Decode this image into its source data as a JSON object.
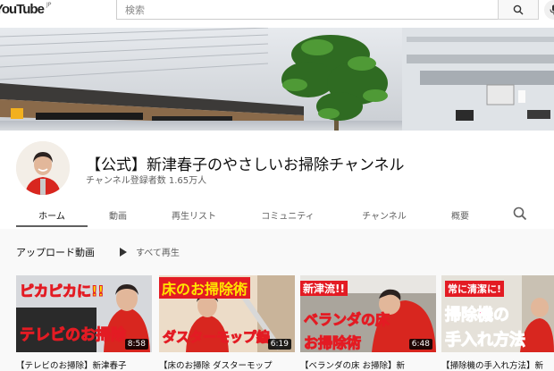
{
  "masthead": {
    "logo_text": "YouTube",
    "logo_region": "JP",
    "search_placeholder": "検索",
    "icons": [
      "search-icon",
      "microphone-icon"
    ]
  },
  "channel": {
    "title": "【公式】新津春子のやさしいお掃除チャンネル",
    "subscribers": "チャンネル登録者数 1.65万人"
  },
  "tabs": [
    {
      "label": "ホーム",
      "active": true
    },
    {
      "label": "動画"
    },
    {
      "label": "再生リスト"
    },
    {
      "label": "コミュニティ"
    },
    {
      "label": "チャンネル"
    },
    {
      "label": "概要"
    }
  ],
  "section": {
    "title": "アップロード動画",
    "play_all": "すべて再生"
  },
  "videos": [
    {
      "title": "【テレビのお掃除】新津春子",
      "duration": "8:58",
      "caption_top": "ピカピカに!!",
      "caption_bottom": "テレビのお掃除"
    },
    {
      "title": "【床のお掃除 ダスターモップ",
      "duration": "6:19",
      "caption_top": "床のお掃除術",
      "caption_bottom": "ダスターモップ編"
    },
    {
      "title": "【ベランダの床 お掃除】新",
      "duration": "6:48",
      "caption_top": "新津流!!",
      "caption_mid": "ベランダの床",
      "caption_bottom": "お掃除術"
    },
    {
      "title": "【掃除機の手入れ方法】新",
      "duration": "",
      "caption_top": "常に清潔に!",
      "caption_mid": "掃除機の",
      "caption_bottom": "手入れ方法"
    }
  ],
  "colors": {
    "accent_red": "#e31b23",
    "caption_yellow": "#ffe600",
    "caption_pink": "#ff2d7a",
    "text_primary": "#0f0f0f",
    "text_secondary": "#606060"
  }
}
